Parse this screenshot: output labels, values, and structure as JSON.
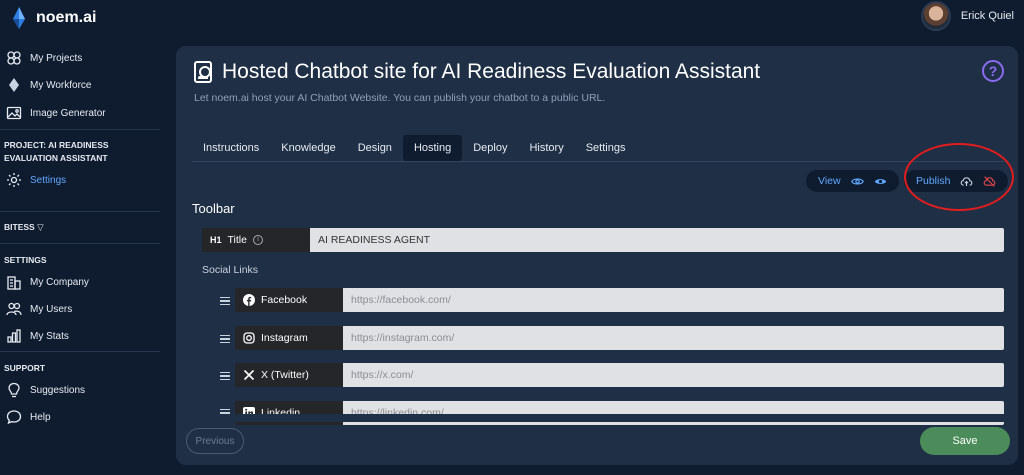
{
  "app": {
    "brand": "noem.ai",
    "user_name": "Erick Quiel"
  },
  "sidebar": {
    "items": [
      {
        "label": "My Projects",
        "icon": "projects-icon"
      },
      {
        "label": "My Workforce",
        "icon": "workforce-icon"
      },
      {
        "label": "Image Generator",
        "icon": "image-icon"
      }
    ],
    "project_heading": "PROJECT: AI READINESS EVALUATION ASSISTANT",
    "project_settings": "Settings",
    "bitess_heading": "BITESS",
    "settings_heading": "SETTINGS",
    "settings_items": [
      {
        "label": "My Company",
        "icon": "building-icon"
      },
      {
        "label": "My Users",
        "icon": "users-icon"
      },
      {
        "label": "My Stats",
        "icon": "stats-icon"
      }
    ],
    "support_heading": "SUPPORT",
    "support_items": [
      {
        "label": "Suggestions",
        "icon": "lightbulb-icon"
      },
      {
        "label": "Help",
        "icon": "chat-icon"
      }
    ]
  },
  "main": {
    "title": "Hosted Chatbot site for AI Readiness Evaluation Assistant",
    "subtitle": "Let noem.ai host your AI Chatbot Website. You can publish your chatbot to a public URL.",
    "help_label": "?",
    "tabs": [
      "Instructions",
      "Knowledge",
      "Design",
      "Hosting",
      "Deploy",
      "History",
      "Settings"
    ],
    "active_tab": "Hosting",
    "view_label": "View",
    "publish_label": "Publish",
    "toolbar_heading": "Toolbar",
    "title_field": {
      "tag": "H1",
      "label": "Title",
      "value": "AI READINESS AGENT"
    },
    "social_heading": "Social Links",
    "social_links": [
      {
        "label": "Facebook",
        "placeholder": "https://facebook.com/",
        "icon": "facebook-icon"
      },
      {
        "label": "Instagram",
        "placeholder": "https://instagram.com/",
        "icon": "instagram-icon"
      },
      {
        "label": "X (Twitter)",
        "placeholder": "https://x.com/",
        "icon": "x-icon"
      },
      {
        "label": "Linkedin",
        "placeholder": "https://linkedin.com/",
        "icon": "linkedin-icon"
      }
    ],
    "previous_label": "Previous",
    "save_label": "Save"
  },
  "colors": {
    "accent": "#5fa8ff",
    "save": "#4c8b5a",
    "highlight": "#e11d1d",
    "help": "#8b6cf0"
  }
}
